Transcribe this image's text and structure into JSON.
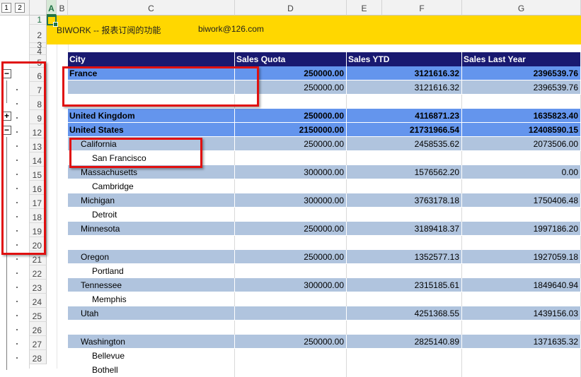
{
  "outline": {
    "levels": [
      "1",
      "2"
    ],
    "buttons": {
      "row6": "−",
      "row9": "+",
      "row12": "−"
    }
  },
  "columns": [
    "A",
    "B",
    "C",
    "D",
    "E",
    "F",
    "G"
  ],
  "rows": [
    "1",
    "2",
    "3",
    "4",
    "5",
    "6",
    "7",
    "8",
    "9",
    "12",
    "13",
    "14",
    "15",
    "16",
    "17",
    "18",
    "19",
    "20",
    "21",
    "22",
    "23",
    "24",
    "25",
    "26",
    "27",
    "28"
  ],
  "banner": {
    "title": "BIWORK -- 报表订阅的功能",
    "email": "biwork@126.com"
  },
  "report": {
    "headers": {
      "city": "City",
      "quota": "Sales Quota",
      "ytd": "Sales YTD",
      "last": "Sales Last Year"
    },
    "rows": [
      {
        "type": "country",
        "name": "France",
        "quota": "250000.00",
        "ytd": "3121616.32",
        "last": "2396539.76"
      },
      {
        "type": "state",
        "name": "",
        "quota": "250000.00",
        "ytd": "3121616.32",
        "last": "2396539.76"
      },
      {
        "type": "blank",
        "name": "",
        "quota": "",
        "ytd": "",
        "last": ""
      },
      {
        "type": "country",
        "name": "United Kingdom",
        "quota": "250000.00",
        "ytd": "4116871.23",
        "last": "1635823.40"
      },
      {
        "type": "country",
        "name": "United States",
        "quota": "2150000.00",
        "ytd": "21731966.54",
        "last": "12408590.15"
      },
      {
        "type": "state",
        "name": "California",
        "quota": "250000.00",
        "ytd": "2458535.62",
        "last": "2073506.00"
      },
      {
        "type": "city",
        "name": "San Francisco",
        "quota": "",
        "ytd": "",
        "last": ""
      },
      {
        "type": "state",
        "name": "Massachusetts",
        "quota": "300000.00",
        "ytd": "1576562.20",
        "last": "0.00"
      },
      {
        "type": "city",
        "name": "Cambridge",
        "quota": "",
        "ytd": "",
        "last": ""
      },
      {
        "type": "state",
        "name": "Michigan",
        "quota": "300000.00",
        "ytd": "3763178.18",
        "last": "1750406.48"
      },
      {
        "type": "city",
        "name": "Detroit",
        "quota": "",
        "ytd": "",
        "last": ""
      },
      {
        "type": "state",
        "name": "Minnesota",
        "quota": "250000.00",
        "ytd": "3189418.37",
        "last": "1997186.20"
      },
      {
        "type": "blank",
        "name": "",
        "quota": "",
        "ytd": "",
        "last": ""
      },
      {
        "type": "state",
        "name": "Oregon",
        "quota": "250000.00",
        "ytd": "1352577.13",
        "last": "1927059.18"
      },
      {
        "type": "city",
        "name": "Portland",
        "quota": "",
        "ytd": "",
        "last": ""
      },
      {
        "type": "state",
        "name": "Tennessee",
        "quota": "300000.00",
        "ytd": "2315185.61",
        "last": "1849640.94"
      },
      {
        "type": "city",
        "name": "Memphis",
        "quota": "",
        "ytd": "",
        "last": ""
      },
      {
        "type": "state",
        "name": "Utah",
        "quota": "",
        "ytd": "4251368.55",
        "last": "1439156.03"
      },
      {
        "type": "blank",
        "name": "",
        "quota": "",
        "ytd": "",
        "last": ""
      },
      {
        "type": "state",
        "name": "Washington",
        "quota": "250000.00",
        "ytd": "2825140.89",
        "last": "1371635.32"
      },
      {
        "type": "city",
        "name": "Bellevue",
        "quota": "",
        "ytd": "",
        "last": ""
      },
      {
        "type": "city",
        "name": "Bothell",
        "quota": "",
        "ytd": "",
        "last": ""
      }
    ]
  },
  "colors": {
    "banner": "#ffd700",
    "header": "#191970",
    "country": "#6495ed",
    "state": "#b0c4de",
    "highlight": "#e01010"
  }
}
